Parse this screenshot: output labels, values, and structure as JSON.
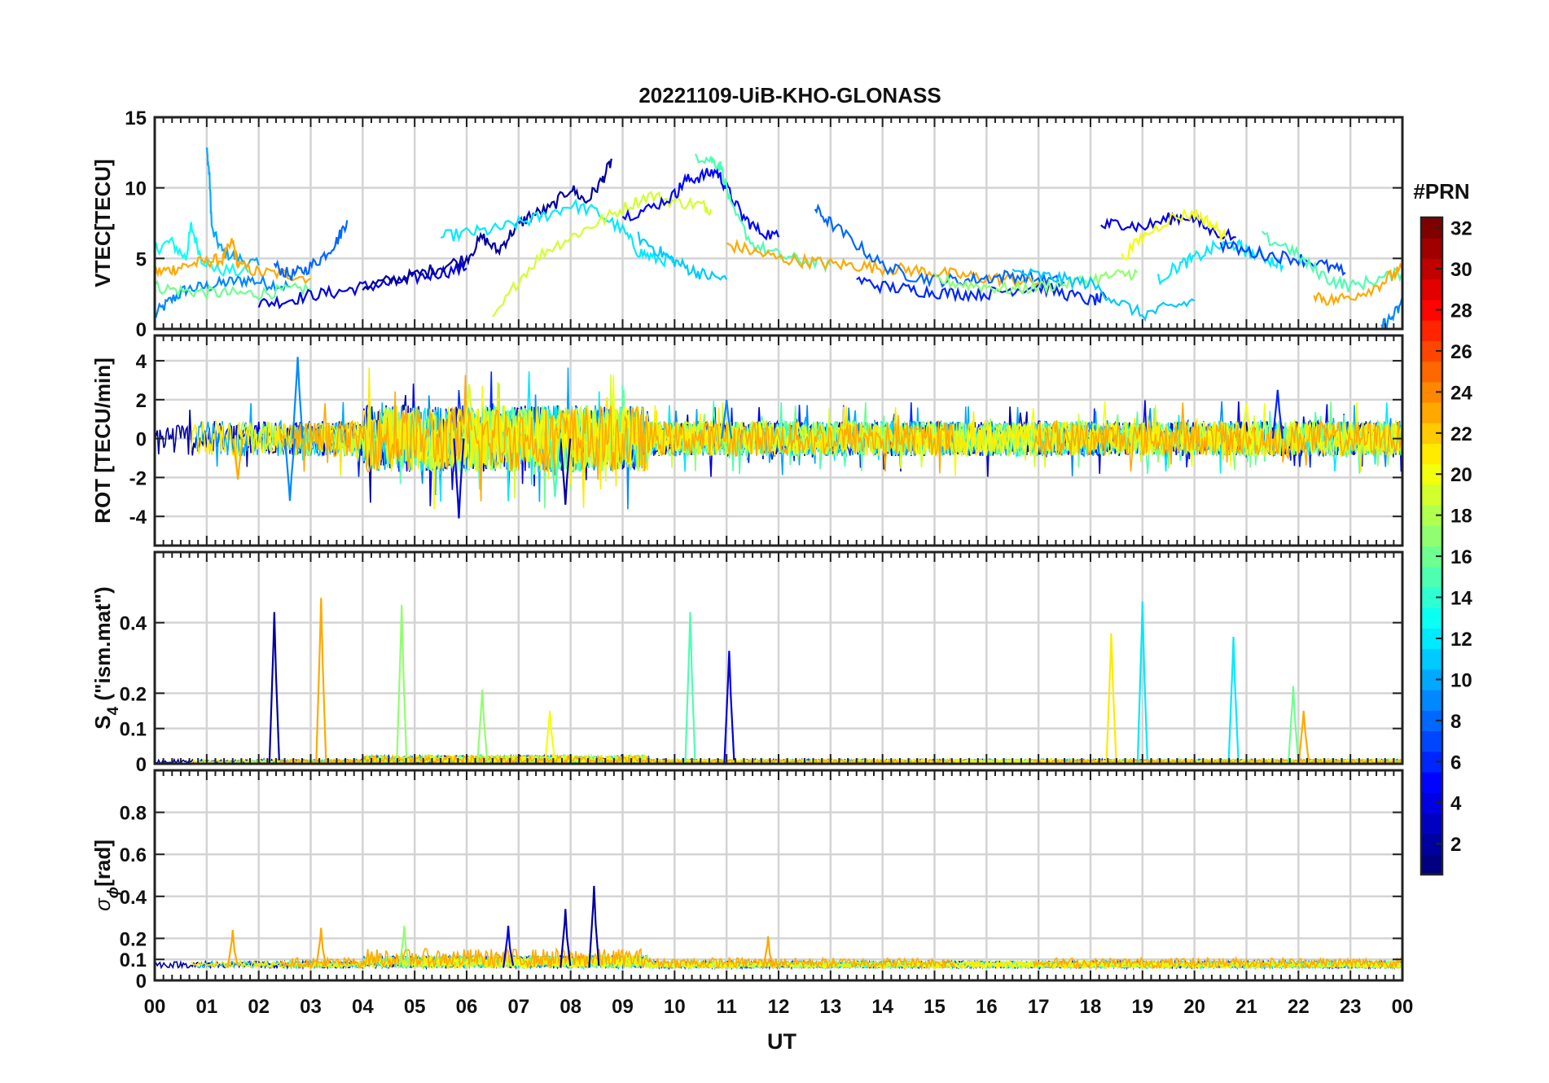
{
  "title": "20221109-UiB-KHO-GLONASS",
  "x_axis": {
    "label": "UT",
    "ticks": [
      "00",
      "01",
      "02",
      "03",
      "04",
      "05",
      "06",
      "07",
      "08",
      "09",
      "10",
      "11",
      "12",
      "13",
      "14",
      "15",
      "16",
      "17",
      "18",
      "19",
      "20",
      "21",
      "22",
      "23",
      "00"
    ]
  },
  "panels": [
    {
      "ylabel": "VTEC[TECU]",
      "ylim": [
        0,
        15
      ],
      "yticks": [
        "0",
        "5",
        "10",
        "15"
      ],
      "ytick_values": [
        0,
        5,
        10,
        15
      ]
    },
    {
      "ylabel": "ROT [TECU/min]",
      "ylim": [
        -5.5,
        5.3
      ],
      "yticks": [
        "-4",
        "-2",
        "0",
        "2",
        "4"
      ],
      "ytick_values": [
        -4,
        -2,
        0,
        2,
        4
      ]
    },
    {
      "ylabel_main": "S",
      "ylabel_sub": "4",
      "ylabel_rest": " (\"ism.mat\")",
      "ylim": [
        0,
        0.6
      ],
      "yticks": [
        "0",
        "0.1",
        "0.2",
        "0.4"
      ],
      "ytick_values": [
        0,
        0.1,
        0.2,
        0.4
      ]
    },
    {
      "ylabel_main": "σ",
      "ylabel_sub": "ϕ",
      "ylabel_rest": "[rad]",
      "ylim": [
        0,
        1.0
      ],
      "yticks": [
        "0",
        "0.1",
        "0.2",
        "0.4",
        "0.6",
        "0.8"
      ],
      "ytick_values": [
        0,
        0.1,
        0.2,
        0.4,
        0.6,
        0.8
      ]
    }
  ],
  "colorbar": {
    "title": "#PRN",
    "range": [
      1,
      32
    ],
    "ticks": [
      "2",
      "4",
      "6",
      "8",
      "10",
      "12",
      "14",
      "16",
      "18",
      "20",
      "22",
      "24",
      "26",
      "28",
      "30",
      "32"
    ],
    "tick_values": [
      2,
      4,
      6,
      8,
      10,
      12,
      14,
      16,
      18,
      20,
      22,
      24,
      26,
      28,
      30,
      32
    ],
    "colormap": "jet"
  },
  "chart_data": [
    {
      "type": "line",
      "quantity": "VTEC",
      "x_unit": "UT hours",
      "series": [
        {
          "prn": 9,
          "x": [
            0.0,
            0.3,
            0.6,
            1.0,
            1.4,
            1.8,
            2.2,
            2.6
          ],
          "y": [
            1.0,
            2.0,
            2.8,
            3.0,
            3.3,
            3.5,
            3.2,
            3.0
          ]
        },
        {
          "prn": 10,
          "x": [
            1.0,
            1.05,
            1.1,
            1.3,
            1.6,
            2.0
          ],
          "y": [
            12.7,
            11.0,
            7.0,
            5.5,
            5.0,
            4.5
          ]
        },
        {
          "prn": 13,
          "x": [
            0.0,
            0.3,
            0.6,
            0.7,
            0.9,
            1.2,
            1.8
          ],
          "y": [
            5.6,
            6.2,
            5.0,
            7.3,
            5.0,
            4.2,
            4.0
          ]
        },
        {
          "prn": 23,
          "x": [
            0.0,
            0.3,
            0.6,
            1.0,
            1.3,
            1.5,
            1.6,
            2.0,
            2.5,
            3.0
          ],
          "y": [
            4.0,
            4.2,
            4.5,
            4.8,
            4.9,
            6.2,
            4.5,
            4.0,
            3.9,
            3.6
          ]
        },
        {
          "prn": 16,
          "x": [
            0.0,
            0.5,
            1.0,
            1.5,
            2.0,
            2.5,
            3.0
          ],
          "y": [
            3.0,
            2.7,
            2.6,
            2.5,
            2.5,
            2.7,
            2.9
          ]
        },
        {
          "prn": 8,
          "x": [
            2.3,
            2.6,
            2.9,
            3.2,
            3.5,
            3.7
          ],
          "y": [
            4.5,
            3.8,
            4.2,
            5.0,
            6.2,
            7.7
          ]
        },
        {
          "prn": 4,
          "x": [
            2.0,
            2.5,
            3.0,
            3.5,
            4.0,
            4.5,
            5.0,
            5.5,
            6.0
          ],
          "y": [
            1.8,
            2.0,
            2.4,
            2.6,
            3.0,
            3.2,
            3.6,
            4.0,
            4.3
          ]
        },
        {
          "prn": 2,
          "x": [
            4.0,
            4.5,
            5.0,
            5.5,
            6.0,
            6.3,
            6.6,
            6.9,
            7.2,
            7.6,
            8.0,
            8.3,
            8.6,
            8.8
          ],
          "y": [
            3.0,
            3.4,
            3.8,
            4.4,
            5.0,
            6.5,
            5.5,
            7.0,
            8.0,
            8.5,
            10.0,
            9.0,
            10.5,
            12.0
          ]
        },
        {
          "prn": 12,
          "x": [
            5.5,
            6.0,
            6.5,
            7.0,
            7.5,
            8.0,
            8.5,
            9.0,
            9.3,
            9.6,
            10.0
          ],
          "y": [
            6.5,
            6.8,
            7.0,
            7.5,
            8.0,
            8.8,
            8.3,
            7.0,
            5.5,
            5.0,
            4.8
          ]
        },
        {
          "prn": 19,
          "x": [
            6.5,
            7.0,
            7.5,
            8.0,
            8.5,
            9.0,
            9.5,
            10.0,
            10.5,
            10.7
          ],
          "y": [
            0.5,
            3.5,
            5.5,
            6.5,
            7.5,
            8.5,
            9.5,
            9.0,
            8.8,
            8.5
          ]
        },
        {
          "prn": 5,
          "x": [
            9.0,
            9.5,
            10.0,
            10.2,
            10.5,
            10.8,
            11.0,
            11.3,
            11.6,
            12.0
          ],
          "y": [
            8.0,
            8.5,
            9.5,
            10.5,
            10.8,
            11.2,
            10.0,
            8.0,
            7.0,
            6.5
          ]
        },
        {
          "prn": 15,
          "x": [
            10.4,
            10.7,
            10.9,
            11.1,
            11.5,
            12.0,
            12.5,
            13.0
          ],
          "y": [
            12.3,
            12.0,
            11.5,
            8.5,
            6.0,
            5.2,
            4.8,
            4.5
          ]
        },
        {
          "prn": 11,
          "x": [
            9.3,
            9.7,
            10.0,
            10.3,
            10.6,
            11.0
          ],
          "y": [
            6.5,
            5.5,
            4.8,
            4.2,
            3.8,
            3.5
          ]
        },
        {
          "prn": 23,
          "x": [
            11.0,
            11.5,
            12.0,
            12.5,
            13.0,
            13.5,
            14.0,
            14.5,
            15.0,
            15.5,
            16.0,
            16.5,
            17.0
          ],
          "y": [
            6.0,
            5.5,
            5.0,
            4.8,
            4.6,
            4.5,
            4.3,
            4.2,
            4.0,
            3.8,
            3.6,
            3.5,
            3.3
          ]
        },
        {
          "prn": 8,
          "x": [
            12.7,
            13.0,
            13.5,
            14.0,
            14.5,
            15.0,
            15.5,
            16.0,
            16.5,
            17.0,
            17.5
          ],
          "y": [
            8.5,
            7.5,
            6.0,
            4.5,
            3.8,
            3.5,
            3.4,
            3.6,
            3.8,
            3.5,
            3.3
          ]
        },
        {
          "prn": 6,
          "x": [
            13.5,
            14.0,
            14.5,
            15.0,
            15.5,
            16.0,
            16.5,
            17.0,
            17.5,
            18.0,
            18.3
          ],
          "y": [
            3.5,
            3.0,
            2.8,
            2.6,
            2.5,
            2.5,
            2.8,
            3.0,
            2.5,
            2.0,
            2.2
          ]
        },
        {
          "prn": 17,
          "x": [
            15.0,
            15.5,
            16.0,
            16.5,
            17.0,
            17.5,
            18.0,
            18.5,
            18.9
          ],
          "y": [
            3.5,
            3.2,
            3.0,
            2.8,
            3.0,
            3.2,
            3.5,
            3.8,
            4.0
          ]
        },
        {
          "prn": 11,
          "x": [
            16.5,
            17.0,
            17.5,
            18.0,
            18.5,
            19.0,
            19.5,
            20.0
          ],
          "y": [
            4.0,
            3.8,
            3.5,
            3.2,
            2.0,
            1.0,
            1.5,
            2.0
          ]
        },
        {
          "prn": 4,
          "x": [
            18.2,
            18.6,
            19.0,
            19.5,
            19.9,
            20.3,
            20.8
          ],
          "y": [
            7.3,
            7.5,
            7.2,
            7.8,
            8.0,
            7.0,
            6.5
          ]
        },
        {
          "prn": 20,
          "x": [
            18.6,
            19.0,
            19.5,
            20.0,
            20.3,
            20.6
          ],
          "y": [
            5.0,
            6.5,
            7.8,
            8.2,
            7.5,
            6.5
          ]
        },
        {
          "prn": 12,
          "x": [
            19.3,
            19.7,
            20.0,
            20.4,
            20.8,
            21.0,
            21.4,
            21.7
          ],
          "y": [
            3.5,
            4.5,
            5.0,
            5.8,
            6.0,
            5.5,
            5.0,
            4.5
          ]
        },
        {
          "prn": 7,
          "x": [
            20.5,
            21.0,
            21.5,
            22.0,
            22.5,
            22.9
          ],
          "y": [
            6.0,
            5.5,
            5.2,
            5.0,
            4.5,
            4.0
          ]
        },
        {
          "prn": 15,
          "x": [
            21.3,
            21.8,
            22.2,
            22.6,
            23.0,
            23.5,
            24.0
          ],
          "y": [
            6.5,
            5.8,
            4.5,
            3.5,
            3.0,
            3.5,
            4.0
          ]
        },
        {
          "prn": 23,
          "x": [
            22.3,
            22.6,
            23.0,
            23.5,
            23.8,
            24.0
          ],
          "y": [
            2.5,
            2.0,
            2.3,
            3.0,
            3.8,
            4.2
          ]
        },
        {
          "prn": 9,
          "x": [
            23.6,
            23.8,
            24.0
          ],
          "y": [
            0.2,
            0.8,
            1.8
          ]
        }
      ]
    },
    {
      "type": "line",
      "quantity": "ROT",
      "x_unit": "UT hours",
      "note_values": "noisy traces centered on 0 TECU/min; largest spikes listed",
      "spikes": [
        {
          "prn": 9,
          "x": 2.75,
          "y": 4.2
        },
        {
          "prn": 9,
          "x": 2.6,
          "y": -3.2
        },
        {
          "prn": 4,
          "x": 5.85,
          "y": -4.1
        },
        {
          "prn": 19,
          "x": 6.05,
          "y": 2.8
        },
        {
          "prn": 2,
          "x": 7.9,
          "y": -3.4
        },
        {
          "prn": 15,
          "x": 7.7,
          "y": -3.0
        },
        {
          "prn": 23,
          "x": 1.6,
          "y": -2.1
        },
        {
          "prn": 9,
          "x": 11.0,
          "y": 2.0
        },
        {
          "prn": 6,
          "x": 21.6,
          "y": 2.5
        },
        {
          "prn": 20,
          "x": 21.0,
          "y": 1.8
        }
      ]
    },
    {
      "type": "line",
      "quantity": "S4",
      "x_unit": "UT hours",
      "spikes": [
        {
          "prn": 2,
          "x": 2.3,
          "y": 0.43
        },
        {
          "prn": 23,
          "x": 3.2,
          "y": 0.47
        },
        {
          "prn": 17,
          "x": 4.75,
          "y": 0.45
        },
        {
          "prn": 17,
          "x": 6.3,
          "y": 0.21
        },
        {
          "prn": 20,
          "x": 7.6,
          "y": 0.15
        },
        {
          "prn": 15,
          "x": 10.3,
          "y": 0.43
        },
        {
          "prn": 4,
          "x": 11.05,
          "y": 0.32
        },
        {
          "prn": 21,
          "x": 18.4,
          "y": 0.37
        },
        {
          "prn": 12,
          "x": 19.0,
          "y": 0.46
        },
        {
          "prn": 12,
          "x": 20.75,
          "y": 0.36
        },
        {
          "prn": 16,
          "x": 21.9,
          "y": 0.22
        },
        {
          "prn": 23,
          "x": 22.1,
          "y": 0.15
        }
      ]
    },
    {
      "type": "line",
      "quantity": "sigma_phi",
      "x_unit": "UT hours",
      "spikes": [
        {
          "prn": 2,
          "x": 8.45,
          "y": 0.45
        },
        {
          "prn": 2,
          "x": 7.9,
          "y": 0.34
        },
        {
          "prn": 4,
          "x": 6.8,
          "y": 0.26
        },
        {
          "prn": 17,
          "x": 4.8,
          "y": 0.26
        },
        {
          "prn": 23,
          "x": 3.2,
          "y": 0.25
        },
        {
          "prn": 23,
          "x": 1.5,
          "y": 0.24
        },
        {
          "prn": 23,
          "x": 11.8,
          "y": 0.21
        }
      ]
    }
  ]
}
